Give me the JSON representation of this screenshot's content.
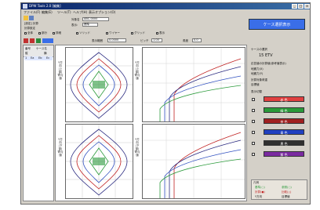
{
  "window": {
    "title": "DPW Tools 2.0 [編集]"
  },
  "menu": [
    "ファイル(F)",
    "編集(E)",
    "ツール(T)",
    "ヘルプ(H)",
    "表示オプション(O)"
  ],
  "toolbar": {
    "field1_label": "対象名",
    "field1_value": "ABC-0000",
    "field2_label": "表示:",
    "field2_value": "標準",
    "options": [
      "全体",
      "部分",
      "詳細",
      "ソリッド",
      "ワイヤー",
      "グリッド",
      "表示"
    ],
    "set_label": "[設定] 計算",
    "sub_label": "計算設定",
    "run_button": "ケース選択表示"
  },
  "filter": {
    "label": "表示範囲",
    "value": "0.0000",
    "label2": "ピッチ",
    "value2": "1.00",
    "label3": "角度",
    "value3": "0.0"
  },
  "leftpanel": {
    "headers": [
      "番号",
      "ケース名",
      "縦",
      "横"
    ],
    "row": [
      "1",
      "Ea",
      "Eb",
      "Ec"
    ]
  },
  "panes": {
    "top_left_label": "Y方向(上部)寄与値",
    "top_mid_label": "Y方向(上部)寄与値",
    "bot_left_label": "Y方向(下部)寄与値",
    "bot_mid_label": "Y方向(下部)寄与値"
  },
  "right": {
    "case_label": "ケースの選択",
    "case_value": "15  ETV",
    "info_title": "応答値の計算値(参考値表示)",
    "info_lines": [
      "地震力(X)",
      "地震力(Y)",
      "計算対象荷重",
      "目標値"
    ],
    "swatch_title": "表示切替",
    "swatches": [
      {
        "label": "赤 色",
        "color": "#e04040"
      },
      {
        "label": "緑 色",
        "color": "#2a9a3a"
      },
      {
        "label": "茶 色",
        "color": "#a02020"
      },
      {
        "label": "青 色",
        "color": "#2040c0"
      },
      {
        "label": "黒 色",
        "color": "#303030"
      },
      {
        "label": "紫 色",
        "color": "#7a2aa0"
      }
    ],
    "legend_title": "凡例",
    "legend_items": [
      "基準(○)",
      "計算(●)",
      "Y方向",
      "参照(○)",
      "比較(△)",
      "目標値"
    ]
  },
  "colors": {
    "accent": "#3a6ee8",
    "titlebar": "#0a246a"
  }
}
